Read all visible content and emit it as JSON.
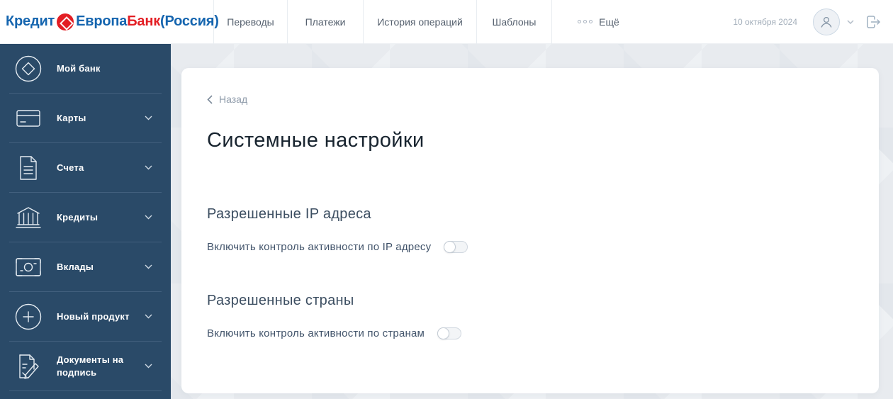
{
  "header": {
    "logo": {
      "part1": "Кредит",
      "part2": "Европа",
      "part3": "Банк",
      "part4": "(Россия)"
    },
    "nav": [
      {
        "label": "Переводы"
      },
      {
        "label": "Платежи"
      },
      {
        "label": "История операций"
      },
      {
        "label": "Шаблоны"
      },
      {
        "label": "Ещё"
      }
    ],
    "date": "10 октября 2024"
  },
  "sidebar": {
    "items": [
      {
        "label": "Мой банк",
        "icon": "diamond-circle-icon",
        "expandable": false
      },
      {
        "label": "Карты",
        "icon": "credit-card-icon",
        "expandable": true
      },
      {
        "label": "Счета",
        "icon": "document-icon",
        "expandable": true
      },
      {
        "label": "Кредиты",
        "icon": "bank-icon",
        "expandable": true
      },
      {
        "label": "Вклады",
        "icon": "banknote-icon",
        "expandable": true
      },
      {
        "label": "Новый продукт",
        "icon": "plus-circle-icon",
        "expandable": true
      },
      {
        "label": "Документы на подпись",
        "icon": "document-sign-icon",
        "expandable": true
      }
    ]
  },
  "main": {
    "back_label": "Назад",
    "title": "Системные настройки",
    "sections": [
      {
        "heading": "Разрешенные IP адреса",
        "toggle_label": "Включить контроль активности по IP адресу",
        "toggle_state": "off"
      },
      {
        "heading": "Разрешенные страны",
        "toggle_label": "Включить контроль активности по странам",
        "toggle_state": "off"
      }
    ]
  },
  "colors": {
    "logo_blue": "#1565af",
    "logo_red": "#e31e24",
    "sidebar_bg": "#2a4a68",
    "page_bg": "#e8ebef",
    "title_text": "#18242f",
    "section_text": "#3c4e61",
    "muted_text": "#8d9aa9"
  }
}
